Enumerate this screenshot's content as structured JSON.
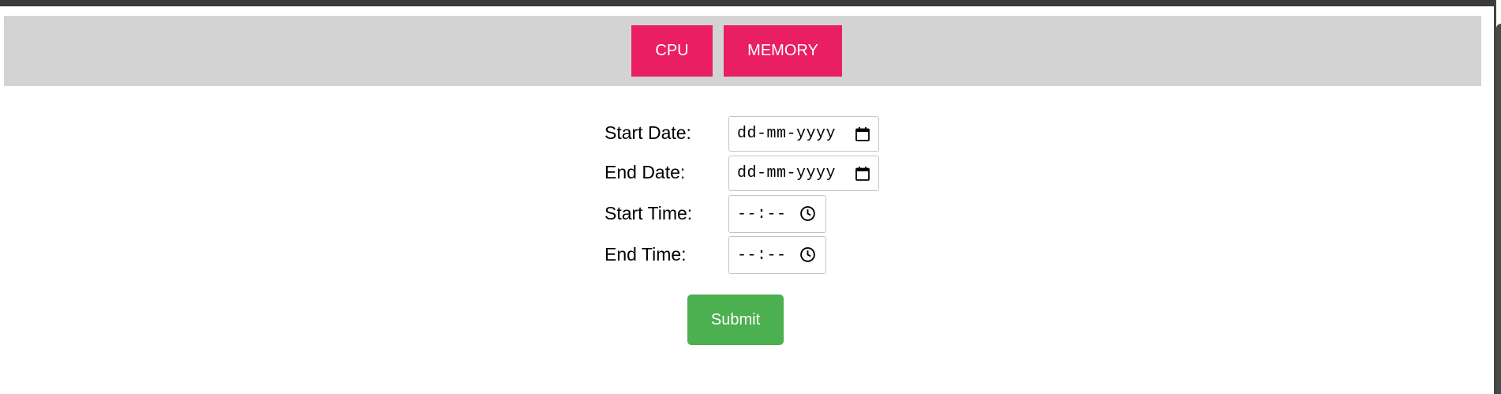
{
  "nav": {
    "cpu_label": "CPU",
    "memory_label": "MEMORY"
  },
  "form": {
    "start_date_label": "Start Date:",
    "start_date_placeholder": "dd-mm-yyyy",
    "end_date_label": "End Date:",
    "end_date_placeholder": "dd-mm-yyyy",
    "start_time_label": "Start Time:",
    "start_time_placeholder": "--:--",
    "end_time_label": "End Time:",
    "end_time_placeholder": "--:--",
    "submit_label": "Submit"
  },
  "colors": {
    "nav_bar_bg": "#d3d3d3",
    "nav_button_bg": "#e91e63",
    "submit_bg": "#4caf50"
  },
  "icons": {
    "date_picker": "calendar-icon",
    "time_picker": "clock-icon"
  }
}
